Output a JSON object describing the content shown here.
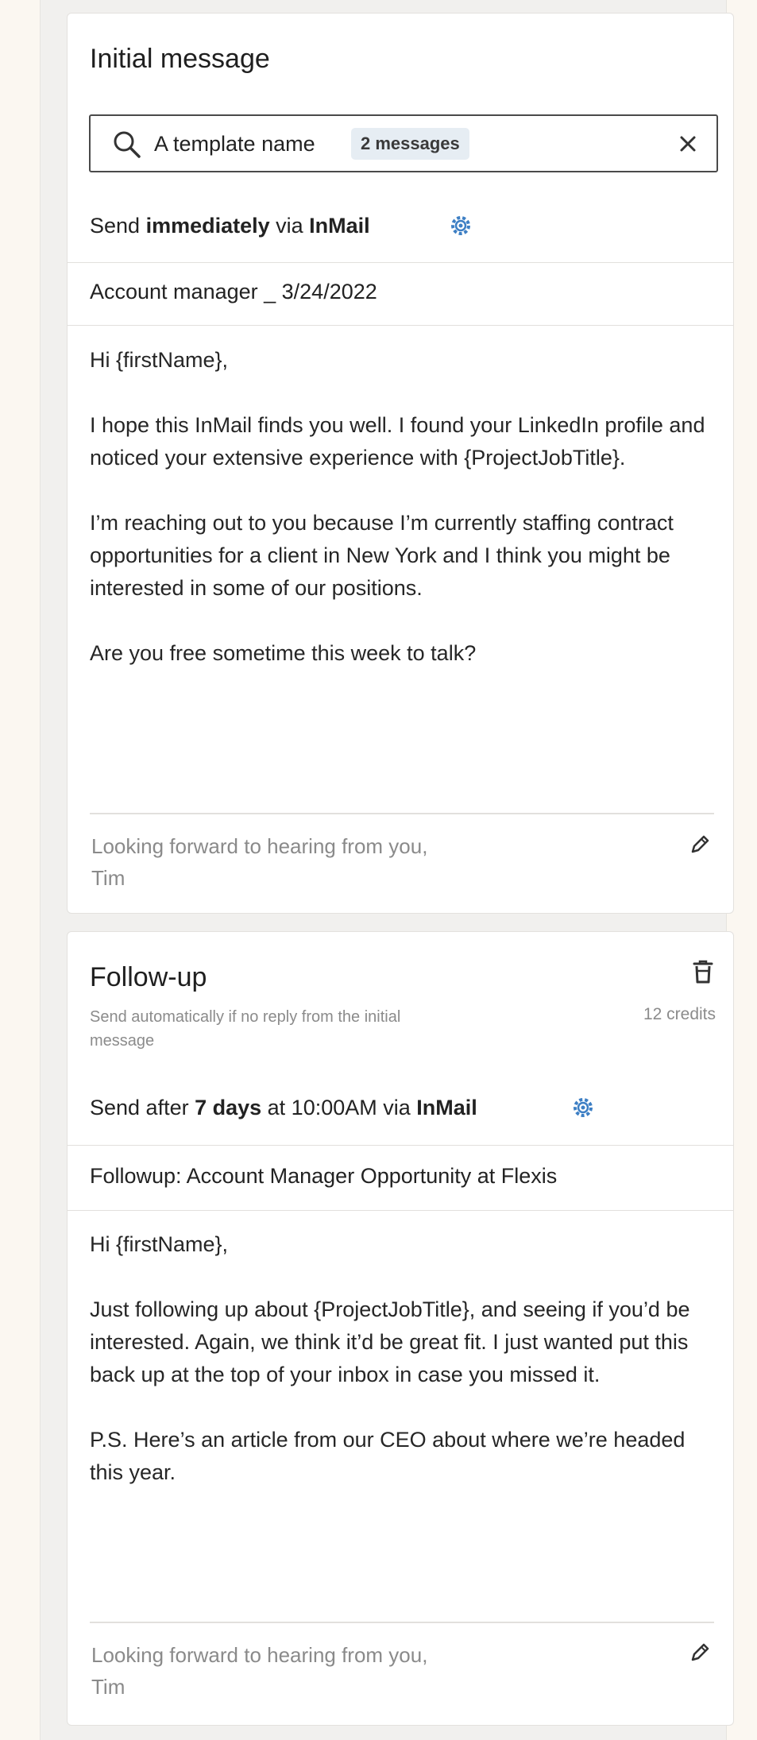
{
  "initial": {
    "title": "Initial message",
    "search": {
      "template_name": "A template name",
      "badge": "2 messages"
    },
    "send_line": {
      "prefix": "Send ",
      "timing": "immediately",
      "middle": " via ",
      "channel": "InMail"
    },
    "subject": "Account manager _ 3/24/2022",
    "body": [
      "Hi {firstName},",
      "I hope this InMail finds you well. I found your LinkedIn profile and noticed your extensive experience with {ProjectJobTitle}.",
      "I’m reaching out to you because I’m currently staffing contract opportunities for a client in New York and I think you might be interested in some of our positions.",
      "Are you free sometime this week to talk?"
    ],
    "signature": {
      "line1": "Looking forward to hearing from you,",
      "line2": "Tim"
    }
  },
  "followup": {
    "title": "Follow-up",
    "note": "Send automatically if no reply from the initial message",
    "credits": "12 credits",
    "send_line": {
      "prefix": "Send after ",
      "delay": "7 days",
      "middle": " at 10:00AM via ",
      "channel": "InMail"
    },
    "subject": "Followup: Account Manager Opportunity at Flexis",
    "body": [
      "Hi {firstName},",
      "Just following up about {ProjectJobTitle}, and seeing if you’d be interested. Again, we think it’d be great fit. I just wanted put this back up at the top of your inbox in case you missed it.",
      "P.S. Here’s an article from our CEO about where we’re headed this year."
    ],
    "signature": {
      "line1": "Looking forward to hearing from you,",
      "line2": "Tim"
    }
  },
  "colors": {
    "accent": "#3d7fc4",
    "background": "#fbf7f1",
    "panel": "#f1f0ee",
    "card": "#ffffff",
    "muted": "#8a8a8a"
  },
  "icons": [
    "search-icon",
    "close-icon",
    "gear-icon",
    "pencil-icon",
    "trash-icon"
  ]
}
